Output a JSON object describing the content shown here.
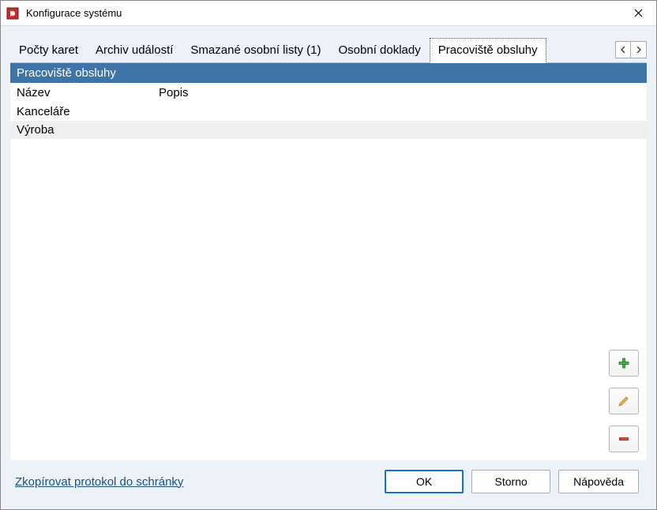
{
  "window": {
    "title": "Konfigurace systému"
  },
  "tabs": {
    "items": [
      {
        "label": "Počty karet"
      },
      {
        "label": "Archiv událostí"
      },
      {
        "label": "Smazané osobní listy (1)"
      },
      {
        "label": "Osobní doklady"
      },
      {
        "label": "Pracoviště obsluhy"
      }
    ],
    "active_index": 4
  },
  "section": {
    "title": "Pracoviště obsluhy"
  },
  "grid": {
    "columns": {
      "name": "Název",
      "desc": "Popis"
    },
    "rows": [
      {
        "name": "Kanceláře",
        "desc": ""
      },
      {
        "name": "Výroba",
        "desc": ""
      }
    ]
  },
  "side_buttons": {
    "add": "add",
    "edit": "edit",
    "remove": "remove"
  },
  "footer": {
    "copy_link": "Zkopírovat protokol do schránky",
    "ok": "OK",
    "cancel": "Storno",
    "help": "Nápověda"
  }
}
